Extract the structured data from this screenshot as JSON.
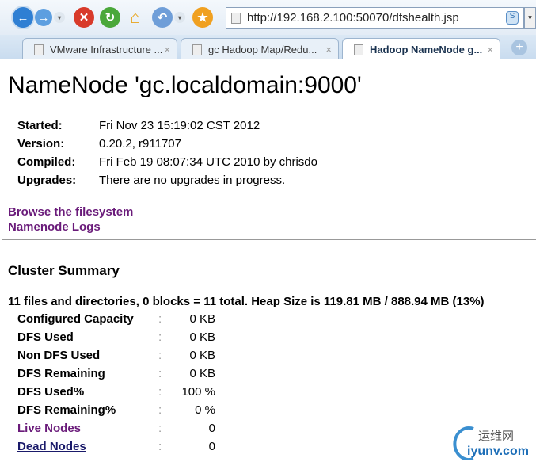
{
  "browser": {
    "url": "http://192.168.2.100:50070/dfshealth.jsp",
    "tabs": [
      {
        "label": "VMware Infrastructure ..."
      },
      {
        "label": "gc Hadoop Map/Redu..."
      },
      {
        "label": "Hadoop NameNode g..."
      }
    ]
  },
  "page": {
    "title": "NameNode 'gc.localdomain:9000'",
    "info": [
      {
        "label": "Started:",
        "value": "Fri Nov 23 15:19:02 CST 2012"
      },
      {
        "label": "Version:",
        "value": "0.20.2, r911707"
      },
      {
        "label": "Compiled:",
        "value": "Fri Feb 19 08:07:34 UTC 2010 by chrisdo"
      },
      {
        "label": "Upgrades:",
        "value": "There are no upgrades in progress."
      }
    ],
    "links": {
      "browse": "Browse the filesystem",
      "logs": "Namenode Logs"
    },
    "cluster_heading": "Cluster Summary",
    "summary": "11 files and directories, 0 blocks = 11 total. Heap Size is 119.81 MB / 888.94 MB (13%)",
    "rows": [
      {
        "label": "Configured Capacity",
        "value": "0 KB"
      },
      {
        "label": "DFS Used",
        "value": "0 KB"
      },
      {
        "label": "Non DFS Used",
        "value": "0 KB"
      },
      {
        "label": "DFS Remaining",
        "value": "0 KB"
      },
      {
        "label": "DFS Used%",
        "value": "100 %"
      },
      {
        "label": "DFS Remaining%",
        "value": "0 %"
      },
      {
        "label": "Live Nodes",
        "value": "0"
      },
      {
        "label": "Dead Nodes",
        "value": "0"
      }
    ],
    "separator": ":"
  },
  "watermark": {
    "cn": "运维网",
    "en": "iyunv.com"
  }
}
